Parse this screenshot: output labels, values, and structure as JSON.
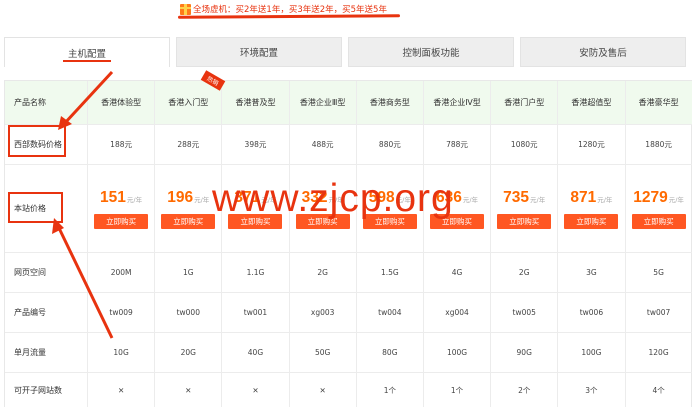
{
  "promo": {
    "icon": "gift-icon",
    "text": "全场虚机：买2年送1年，买3年送2年，买5年送5年"
  },
  "tabs": [
    {
      "label": "主机配置",
      "active": true
    },
    {
      "label": "环境配置",
      "active": false
    },
    {
      "label": "控制面板功能",
      "active": false
    },
    {
      "label": "安防及售后",
      "active": false
    }
  ],
  "table": {
    "header_label": "产品名称",
    "products": [
      "香港体验型",
      "香港入门型",
      "香港普及型",
      "香港企业Ⅲ型",
      "香港商务型",
      "香港企业Ⅳ型",
      "香港门户型",
      "香港超值型",
      "香港豪华型"
    ],
    "hot_badge": "热销",
    "rows": {
      "west_price": {
        "label": "西部数码价格",
        "values": [
          "188元",
          "288元",
          "398元",
          "488元",
          "880元",
          "788元",
          "1080元",
          "1280元",
          "1880元"
        ]
      },
      "site_price": {
        "label": "本站价格",
        "values": [
          "151",
          "196",
          "371",
          "332",
          "598",
          "636",
          "735",
          "871",
          "1279"
        ],
        "unit": "元/年",
        "button": "立即购买"
      },
      "web_space": {
        "label": "网页空间",
        "values": [
          "200M",
          "1G",
          "1.1G",
          "2G",
          "1.5G",
          "4G",
          "2G",
          "3G",
          "5G"
        ]
      },
      "product_code": {
        "label": "产品编号",
        "values": [
          "tw009",
          "tw000",
          "tw001",
          "xg003",
          "tw004",
          "xg004",
          "tw005",
          "tw006",
          "tw007"
        ]
      },
      "traffic": {
        "label": "单月流量",
        "values": [
          "10G",
          "20G",
          "40G",
          "50G",
          "80G",
          "100G",
          "90G",
          "100G",
          "120G"
        ]
      },
      "sites": {
        "label": "可开子网站数",
        "values": [
          "✕",
          "✕",
          "✕",
          "✕",
          "1个",
          "1个",
          "2个",
          "3个",
          "4个"
        ]
      }
    }
  },
  "watermark": "www.zjcp.org",
  "colors": {
    "accent": "#e8330f",
    "price": "#ff6a00",
    "button": "#ff5722",
    "header_bg": "#f0faee"
  }
}
